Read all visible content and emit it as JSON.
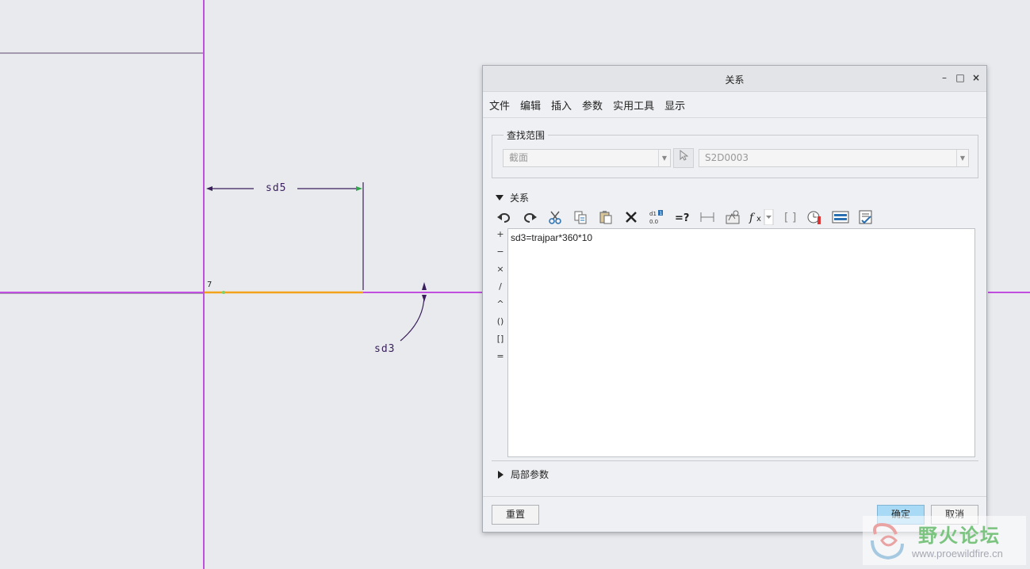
{
  "sketch": {
    "dim_sd5": "sd5",
    "dim_sd3": "sd3",
    "corner_label": "7"
  },
  "dialog": {
    "title": "关系",
    "window_controls": {
      "minimize": "–",
      "maximize": "□",
      "close": "×"
    },
    "menu": [
      "文件",
      "编辑",
      "插入",
      "参数",
      "实用工具",
      "显示"
    ],
    "scope": {
      "legend": "查找范围",
      "type_value": "截面",
      "name_value": "S2D0003"
    },
    "relations_header": "关系",
    "toolbar_icons": [
      "undo-icon",
      "redo-icon",
      "cut-icon",
      "copy-icon",
      "paste-icon",
      "delete-icon",
      "switch-dimensions-icon",
      "evaluate-icon",
      "show-dimension-icon",
      "sort-relations-icon",
      "insert-function-icon",
      "insert-parentheses-icon",
      "verify-icon",
      "execute-icon",
      "params-icon"
    ],
    "operators": [
      "+",
      "−",
      "×",
      "/",
      "^",
      "()",
      "[]",
      "="
    ],
    "editor_text": "sd3=trajpar*360*10",
    "local_params_header": "局部参数",
    "buttons": {
      "reset": "重置",
      "ok": "确定",
      "cancel": "取消"
    }
  },
  "watermark": {
    "title": "野火论坛",
    "url": "www.proewildfire.cn"
  },
  "colors": {
    "axis": "#c04fe0",
    "dimension": "#3a1f5c",
    "highlight": "#f2a31b",
    "ok_button": "#a9daf5"
  }
}
